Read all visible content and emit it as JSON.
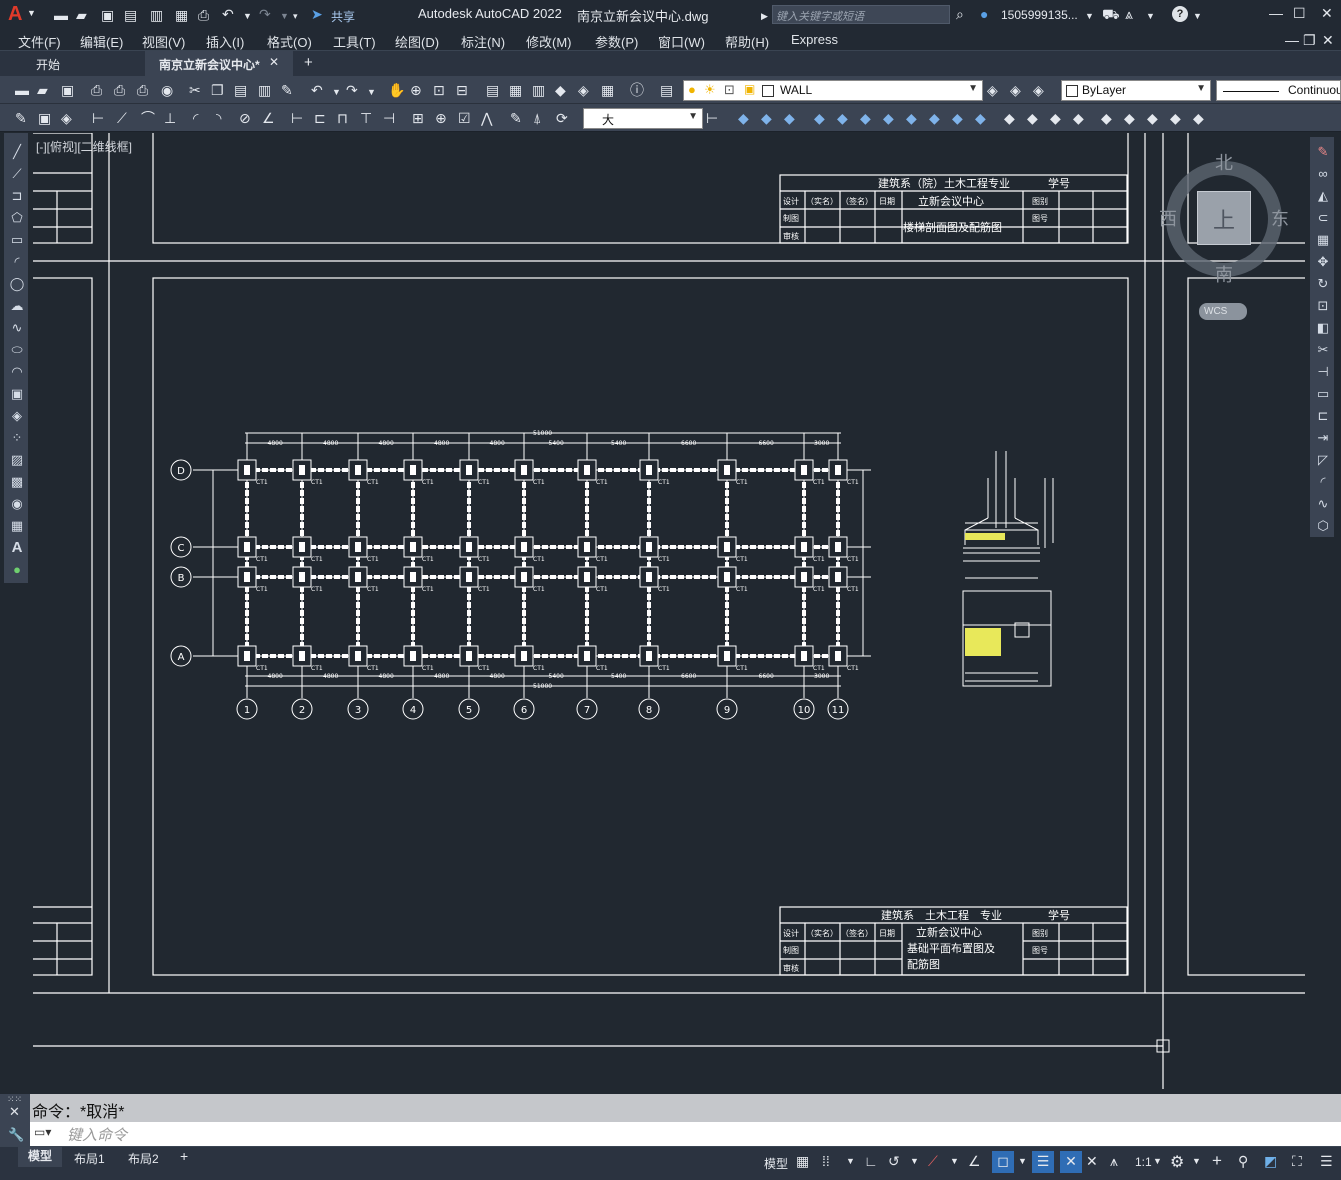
{
  "app": {
    "logo": "A",
    "title": "Autodesk AutoCAD 2022",
    "filename": "南京立新会议中心.dwg",
    "share_label": "共享",
    "search_placeholder": "键入关键字或短语",
    "user": "1505999135...",
    "help_icon": "?"
  },
  "menu": {
    "items": [
      "文件(F)",
      "编辑(E)",
      "视图(V)",
      "插入(I)",
      "格式(O)",
      "工具(T)",
      "绘图(D)",
      "标注(N)",
      "修改(M)",
      "参数(P)",
      "窗口(W)",
      "帮助(H)",
      "Express"
    ]
  },
  "tabs": {
    "start": "开始",
    "active": "南京立新会议中心*",
    "add": "+"
  },
  "toolbar": {
    "layer_value": "WALL",
    "color_value": "ByLayer",
    "linetype_value": "Continuous",
    "textstyle_value": "大"
  },
  "viewport": {
    "label": "[-][俯视][二维线框]",
    "viewcube": {
      "north": "北",
      "south": "南",
      "east": "东",
      "west": "西",
      "top": "上",
      "wcs": "WCS"
    }
  },
  "drawing": {
    "titleblock_top": {
      "line1": "建筑系（院）土木工程专业",
      "line1_right": "学号",
      "project": "立新会议中心",
      "drawing_name": "楼梯剖面图及配筋图",
      "design": "设计",
      "draw": "制图",
      "review": "审核",
      "name_real": "（实名）",
      "name_sign": "（签名）",
      "date": "日期",
      "category": "图别",
      "number": "图号"
    },
    "titleblock_bottom": {
      "line1": "建筑系　土木工程　专业",
      "line1_right": "学号",
      "project": "立新会议中心",
      "drawing_name_1": "基础平面布置图及",
      "drawing_name_2": "配筋图",
      "design": "设计",
      "draw": "制图",
      "review": "审核",
      "name_real": "（实名）",
      "name_sign": "（签名）",
      "date": "日期",
      "category": "图别",
      "number": "图号"
    },
    "grid_x_labels": [
      "1",
      "2",
      "3",
      "4",
      "5",
      "6",
      "7",
      "8",
      "9",
      "10",
      "11"
    ],
    "grid_y_labels": [
      "D",
      "C",
      "B",
      "A"
    ],
    "top_dims": [
      "4800",
      "4800",
      "4800",
      "4800",
      "4800",
      "5400",
      "5400",
      "6600",
      "6600",
      "3000"
    ],
    "total_dim": "51000",
    "footing_label": "CT1"
  },
  "command": {
    "history": "命令：*取消*",
    "placeholder": "键入命令"
  },
  "layouts": [
    "模型",
    "布局1",
    "布局2"
  ],
  "status": {
    "model_label": "模型",
    "scale": "1:1"
  }
}
